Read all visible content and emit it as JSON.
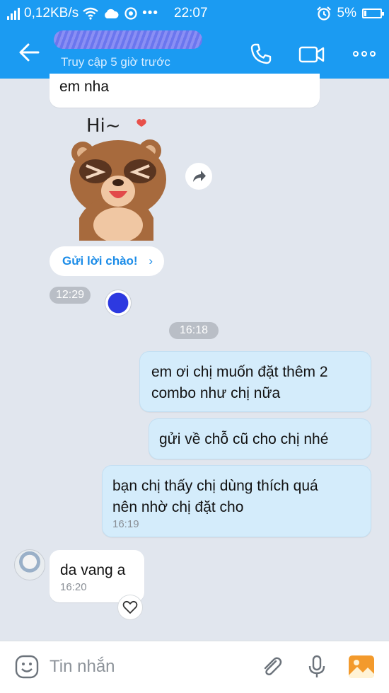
{
  "status_bar": {
    "speed": "0,12KB/s",
    "time": "22:07",
    "battery": "5%",
    "icons": [
      "signal-icon",
      "wifi-icon",
      "cloud-icon",
      "vpn-icon",
      "more-dots-icon",
      "alarm-icon",
      "battery-icon"
    ]
  },
  "header": {
    "subtitle": "Truy cập 5 giờ trước",
    "icons": [
      "back-arrow-icon",
      "phone-icon",
      "video-call-icon",
      "more-icon"
    ]
  },
  "messages": [
    {
      "dir": "in",
      "text": "em nha"
    },
    {
      "dir": "in",
      "type": "sticker",
      "sticker_text": "Hi~"
    },
    {
      "dir": "in",
      "type": "greeting",
      "label": "Gửi lời chào!"
    },
    {
      "dir": "in",
      "time": "12:29"
    },
    {
      "dir": "system",
      "time": "16:18"
    },
    {
      "dir": "out",
      "text_lines": [
        "em ơi chị muốn đặt thêm 2",
        "combo như chị nữa"
      ]
    },
    {
      "dir": "out",
      "text": "gửi về chỗ cũ  cho chị nhé"
    },
    {
      "dir": "out",
      "text_lines": [
        "bạn chị thấy  chị dùng thích quá",
        "nên nhờ chị đặt cho"
      ],
      "time": "16:19"
    },
    {
      "dir": "in",
      "text": "da vang a",
      "time": "16:20"
    }
  ],
  "composer": {
    "placeholder": "Tin nhắn",
    "icons": [
      "emoji-icon",
      "attach-icon",
      "mic-icon",
      "image-icon"
    ]
  },
  "colors": {
    "accent": "#1b9bf2",
    "out_bubble": "#d4ecfb",
    "bg": "#e1e6ee"
  }
}
